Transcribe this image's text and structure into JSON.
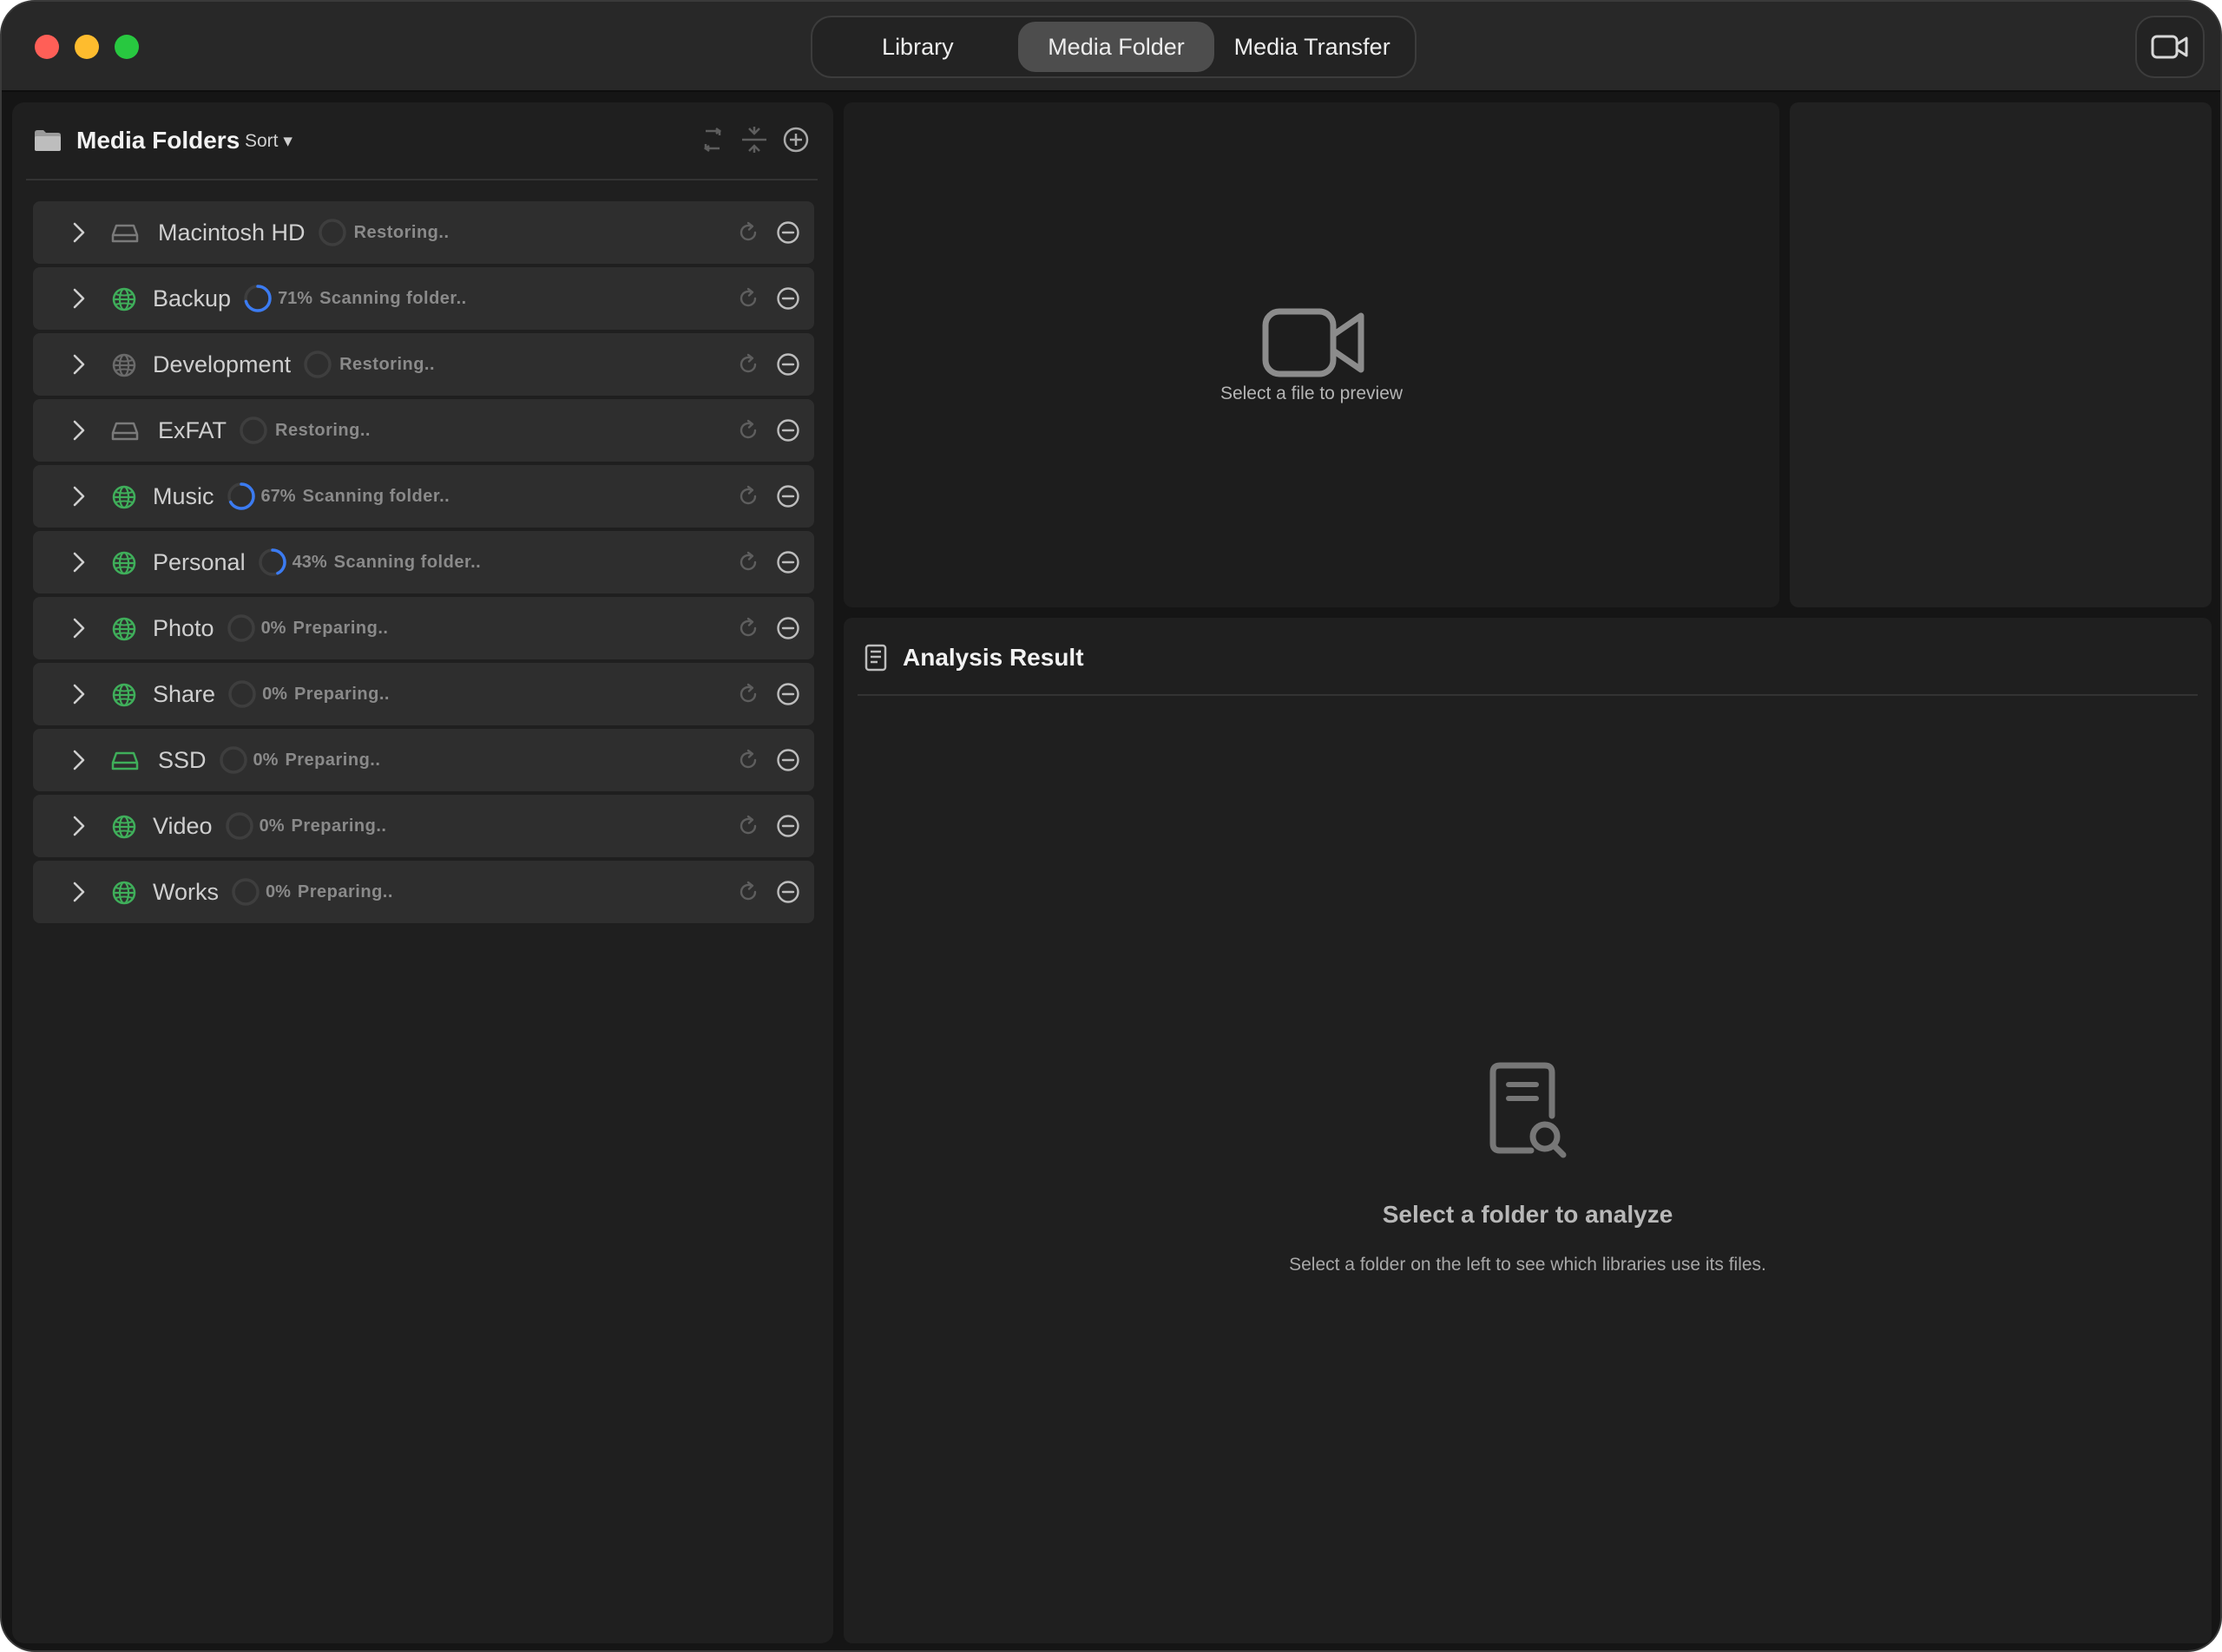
{
  "window": {
    "tabs": [
      {
        "label": "Library"
      },
      {
        "label": "Media Folder",
        "selected": true
      },
      {
        "label": "Media Transfer"
      }
    ],
    "camera_button_icon": "video-camera-icon"
  },
  "sidebar": {
    "title": "Media Folders",
    "sort_label": "Sort ▾",
    "header_icons": [
      "folder-icon",
      "sync-icon",
      "collapse-icon",
      "add-icon"
    ],
    "folders": [
      {
        "name": "Macintosh HD",
        "kind": "drive-icon",
        "progress": "",
        "status": "Restoring.."
      },
      {
        "name": "Backup",
        "kind": "network-globe-icon",
        "progress": "71%",
        "status": "Scanning folder.."
      },
      {
        "name": "Development",
        "kind": "network-globe-icon",
        "progress": "",
        "status": "Restoring.."
      },
      {
        "name": "ExFAT",
        "kind": "drive-icon",
        "progress": "",
        "status": "Restoring.."
      },
      {
        "name": "Music",
        "kind": "network-globe-icon",
        "progress": "67%",
        "status": "Scanning folder.."
      },
      {
        "name": "Personal",
        "kind": "network-globe-icon",
        "progress": "43%",
        "status": "Scanning folder.."
      },
      {
        "name": "Photo",
        "kind": "network-globe-icon",
        "progress": "0%",
        "status": "Preparing.."
      },
      {
        "name": "Share",
        "kind": "network-globe-icon",
        "progress": "0%",
        "status": "Preparing.."
      },
      {
        "name": "SSD",
        "kind": "drive-icon",
        "progress": "0%",
        "status": "Preparing.."
      },
      {
        "name": "Video",
        "kind": "network-globe-icon",
        "progress": "0%",
        "status": "Preparing.."
      },
      {
        "name": "Works",
        "kind": "network-globe-icon",
        "progress": "0%",
        "status": "Preparing.."
      }
    ]
  },
  "preview": {
    "hint": "Select a file to preview"
  },
  "analysis": {
    "title": "Analysis Result",
    "empty_title": "Select a folder to analyze",
    "empty_subtitle": "Select a folder on the left to see which libraries use its files."
  },
  "colors": {
    "accent_progress": "#3b7bf2",
    "network_icon": "#3fae5a",
    "drive_icon": "#8a8a8a"
  }
}
